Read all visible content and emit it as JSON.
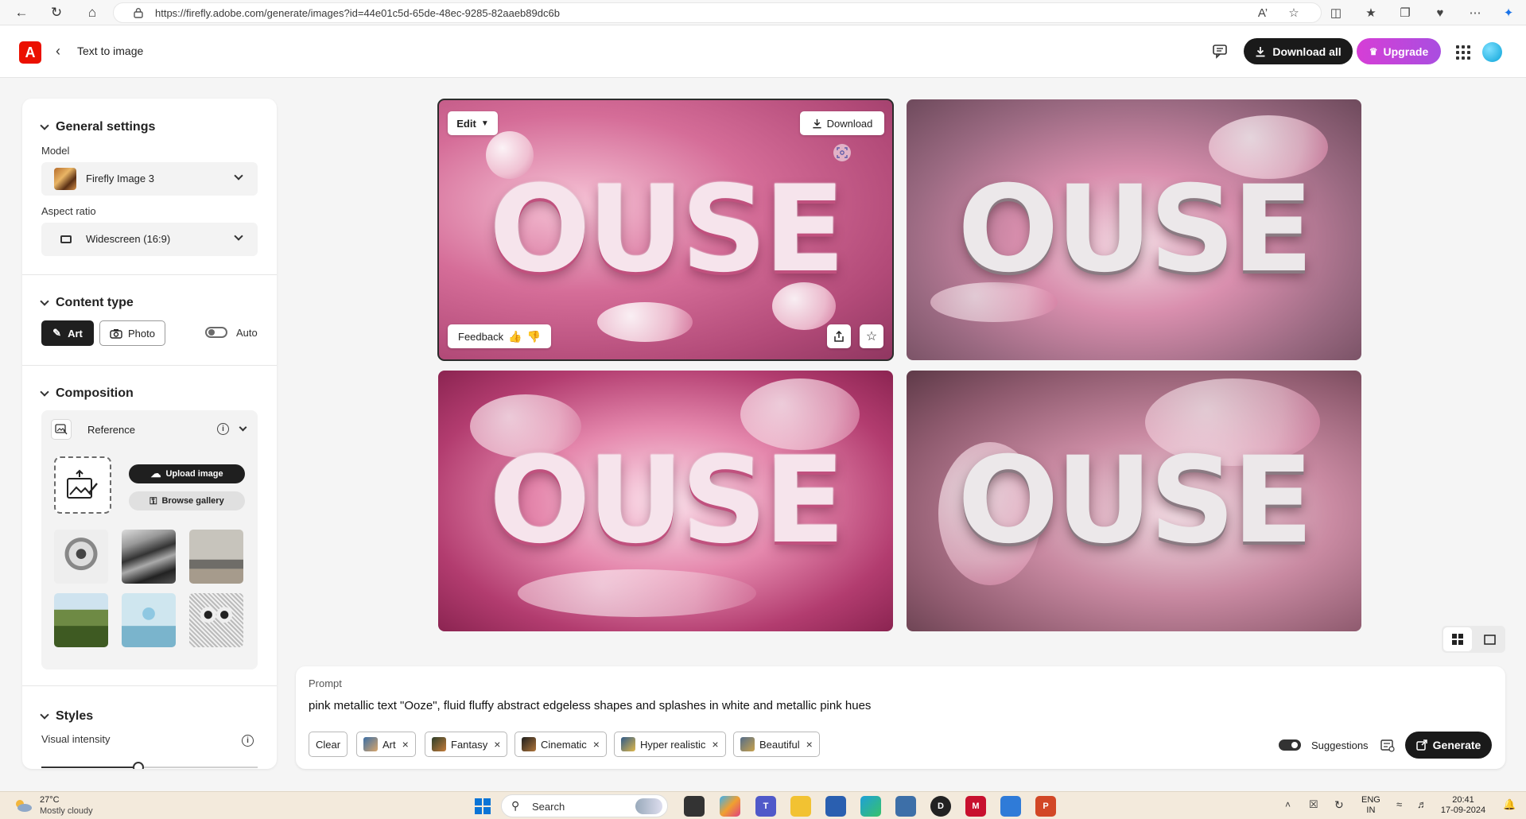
{
  "browser": {
    "url": "https://firefly.adobe.com/generate/images?id=44e01c5d-65de-48ec-9285-82aaeb89dc6b"
  },
  "header": {
    "logo_text": "A",
    "title": "Text to image",
    "download_all_label": "Download all",
    "upgrade_label": "Upgrade"
  },
  "general_settings": {
    "heading": "General settings",
    "model_label": "Model",
    "model_value": "Firefly Image 3",
    "aspect_label": "Aspect ratio",
    "aspect_value": "Widescreen (16:9)"
  },
  "content_type": {
    "heading": "Content type",
    "art_label": "Art",
    "photo_label": "Photo",
    "auto_label": "Auto",
    "auto_on": false
  },
  "composition": {
    "heading": "Composition",
    "reference_label": "Reference",
    "upload_label": "Upload image",
    "browse_label": "Browse gallery"
  },
  "styles": {
    "heading": "Styles",
    "intensity_label": "Visual intensity",
    "intensity_level": 0.45
  },
  "images": {
    "word": "OUSE",
    "edit_label": "Edit",
    "download_label": "Download",
    "feedback_label": "Feedback"
  },
  "prompt": {
    "label": "Prompt",
    "text": "pink metallic text \"Ooze\", fluid fluffy abstract edgeless shapes and splashes in white and metallic pink hues",
    "clear_label": "Clear",
    "tags": [
      "Art",
      "Fantasy",
      "Cinematic",
      "Hyper realistic",
      "Beautiful"
    ],
    "tag_close": "×",
    "suggestions_label": "Suggestions",
    "suggestions_on": true,
    "generate_label": "Generate"
  },
  "taskbar": {
    "temperature": "27°C",
    "weather": "Mostly cloudy",
    "search_label": "Search",
    "lang_top": "ENG",
    "lang_bottom": "IN",
    "time": "20:41",
    "date": "17-09-2024"
  },
  "colors": {
    "accent_dark": "#1a1a1a",
    "upgrade_start": "#d63ed6",
    "upgrade_end": "#a94ee0",
    "adobe_red": "#eb1000"
  }
}
